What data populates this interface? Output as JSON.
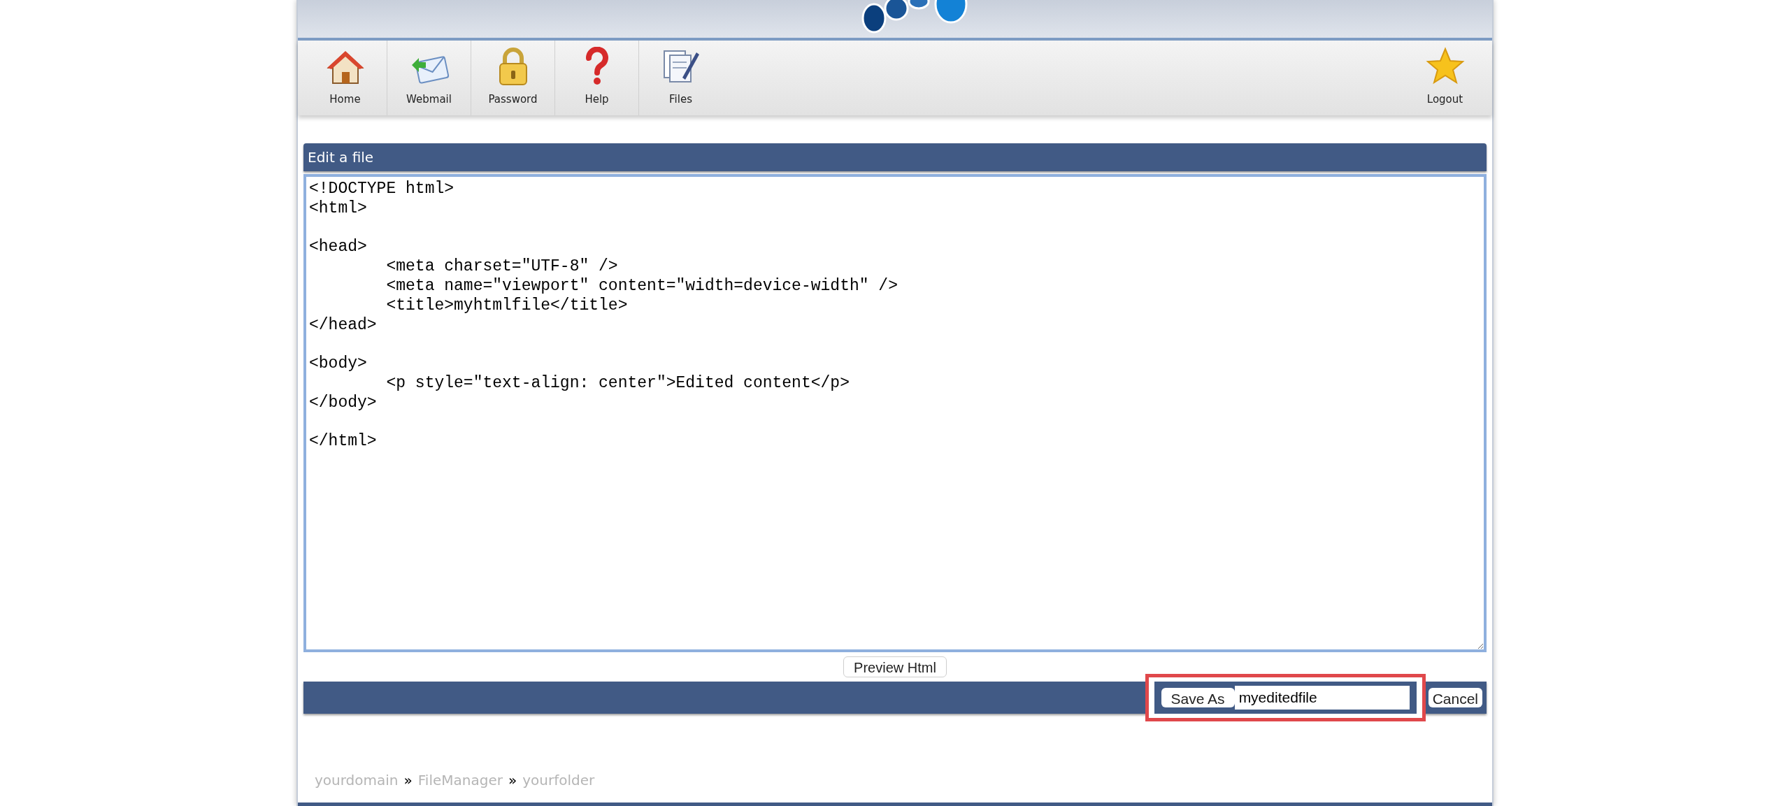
{
  "toolbar": {
    "items": [
      {
        "label": "Home",
        "kind": "home"
      },
      {
        "label": "Webmail",
        "kind": "webmail"
      },
      {
        "label": "Password",
        "kind": "password"
      },
      {
        "label": "Help",
        "kind": "help"
      },
      {
        "label": "Files",
        "kind": "files"
      }
    ],
    "logout": {
      "label": "Logout",
      "kind": "logout"
    }
  },
  "panel": {
    "title": "Edit a file",
    "editor": {
      "content": "<!DOCTYPE html>\n<html>\n\n<head>\n\t<meta charset=\"UTF-8\" />\n\t<meta name=\"viewport\" content=\"width=device-width\" />\n\t<title>myhtmlfile</title>\n</head>\n\n<body>\n\t<p style=\"text-align: center\">Edited content</p>\n</body>\n\n</html>"
    }
  },
  "preview_button": "Preview Html",
  "save_bar": {
    "save_button": "Save As",
    "filename": "myeditedfile",
    "cancel_button": "Cancel",
    "highlighted": true
  },
  "breadcrumb": [
    {
      "label": "yourdomain"
    },
    {
      "label": "FileManager"
    },
    {
      "label": "yourfolder"
    }
  ],
  "breadcrumb_separator": "»"
}
